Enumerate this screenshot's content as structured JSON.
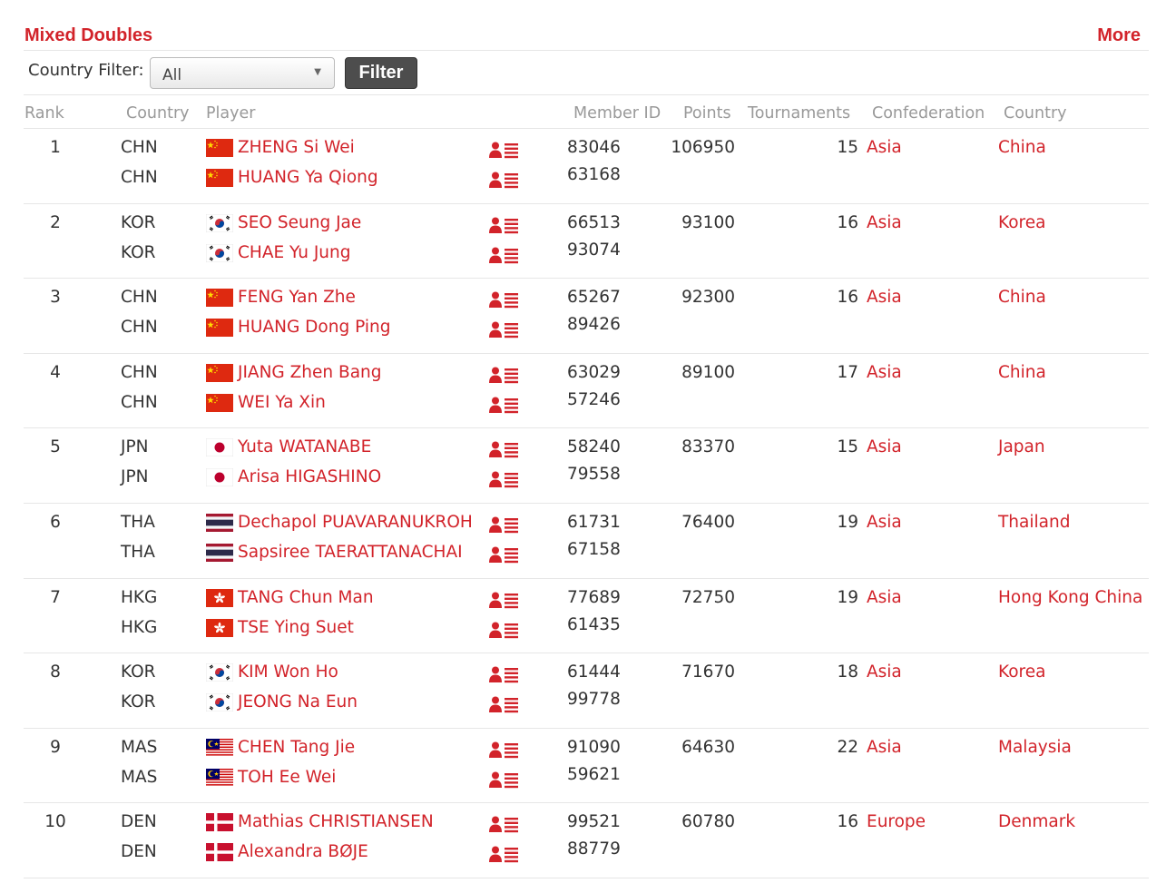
{
  "header": {
    "title": "Mixed Doubles",
    "more_label": "More"
  },
  "filter": {
    "label": "Country Filter:",
    "selected": "All",
    "button_label": "Filter"
  },
  "columns": {
    "rank": "Rank",
    "country_code": "Country",
    "player": "Player",
    "member_id": "Member ID",
    "points": "Points",
    "tournaments": "Tournaments",
    "confederation": "Confederation",
    "country": "Country"
  },
  "colors": {
    "accent": "#d2232a",
    "header_text": "#999999",
    "button_bg": "#4d4d4d"
  },
  "rows": [
    {
      "rank": "1",
      "points": "106950",
      "tournaments": "15",
      "confederation": "Asia",
      "country": "China",
      "players": [
        {
          "code": "CHN",
          "flag": "CHN",
          "name": "ZHENG Si Wei",
          "member_id": "83046"
        },
        {
          "code": "CHN",
          "flag": "CHN",
          "name": "HUANG Ya Qiong",
          "member_id": "63168"
        }
      ]
    },
    {
      "rank": "2",
      "points": "93100",
      "tournaments": "16",
      "confederation": "Asia",
      "country": "Korea",
      "players": [
        {
          "code": "KOR",
          "flag": "KOR",
          "name": "SEO Seung Jae",
          "member_id": "66513"
        },
        {
          "code": "KOR",
          "flag": "KOR",
          "name": "CHAE Yu Jung",
          "member_id": "93074"
        }
      ]
    },
    {
      "rank": "3",
      "points": "92300",
      "tournaments": "16",
      "confederation": "Asia",
      "country": "China",
      "players": [
        {
          "code": "CHN",
          "flag": "CHN",
          "name": "FENG Yan Zhe",
          "member_id": "65267"
        },
        {
          "code": "CHN",
          "flag": "CHN",
          "name": "HUANG Dong Ping",
          "member_id": "89426"
        }
      ]
    },
    {
      "rank": "4",
      "points": "89100",
      "tournaments": "17",
      "confederation": "Asia",
      "country": "China",
      "players": [
        {
          "code": "CHN",
          "flag": "CHN",
          "name": "JIANG Zhen Bang",
          "member_id": "63029"
        },
        {
          "code": "CHN",
          "flag": "CHN",
          "name": "WEI Ya Xin",
          "member_id": "57246"
        }
      ]
    },
    {
      "rank": "5",
      "points": "83370",
      "tournaments": "15",
      "confederation": "Asia",
      "country": "Japan",
      "players": [
        {
          "code": "JPN",
          "flag": "JPN",
          "name": "Yuta WATANABE",
          "member_id": "58240"
        },
        {
          "code": "JPN",
          "flag": "JPN",
          "name": "Arisa HIGASHINO",
          "member_id": "79558"
        }
      ]
    },
    {
      "rank": "6",
      "points": "76400",
      "tournaments": "19",
      "confederation": "Asia",
      "country": "Thailand",
      "players": [
        {
          "code": "THA",
          "flag": "THA",
          "name": "Dechapol PUAVARANUKROH",
          "member_id": "61731"
        },
        {
          "code": "THA",
          "flag": "THA",
          "name": "Sapsiree TAERATTANACHAI",
          "member_id": "67158"
        }
      ]
    },
    {
      "rank": "7",
      "points": "72750",
      "tournaments": "19",
      "confederation": "Asia",
      "country": "Hong Kong China",
      "players": [
        {
          "code": "HKG",
          "flag": "HKG",
          "name": "TANG Chun Man",
          "member_id": "77689"
        },
        {
          "code": "HKG",
          "flag": "HKG",
          "name": "TSE Ying Suet",
          "member_id": "61435"
        }
      ]
    },
    {
      "rank": "8",
      "points": "71670",
      "tournaments": "18",
      "confederation": "Asia",
      "country": "Korea",
      "players": [
        {
          "code": "KOR",
          "flag": "KOR",
          "name": "KIM Won Ho",
          "member_id": "61444"
        },
        {
          "code": "KOR",
          "flag": "KOR",
          "name": "JEONG Na Eun",
          "member_id": "99778"
        }
      ]
    },
    {
      "rank": "9",
      "points": "64630",
      "tournaments": "22",
      "confederation": "Asia",
      "country": "Malaysia",
      "players": [
        {
          "code": "MAS",
          "flag": "MAS",
          "name": "CHEN Tang Jie",
          "member_id": "91090"
        },
        {
          "code": "MAS",
          "flag": "MAS",
          "name": "TOH Ee Wei",
          "member_id": "59621"
        }
      ]
    },
    {
      "rank": "10",
      "points": "60780",
      "tournaments": "16",
      "confederation": "Europe",
      "country": "Denmark",
      "players": [
        {
          "code": "DEN",
          "flag": "DEN",
          "name": "Mathias CHRISTIANSEN",
          "member_id": "99521"
        },
        {
          "code": "DEN",
          "flag": "DEN",
          "name": "Alexandra BØJE",
          "member_id": "88779"
        }
      ]
    }
  ]
}
